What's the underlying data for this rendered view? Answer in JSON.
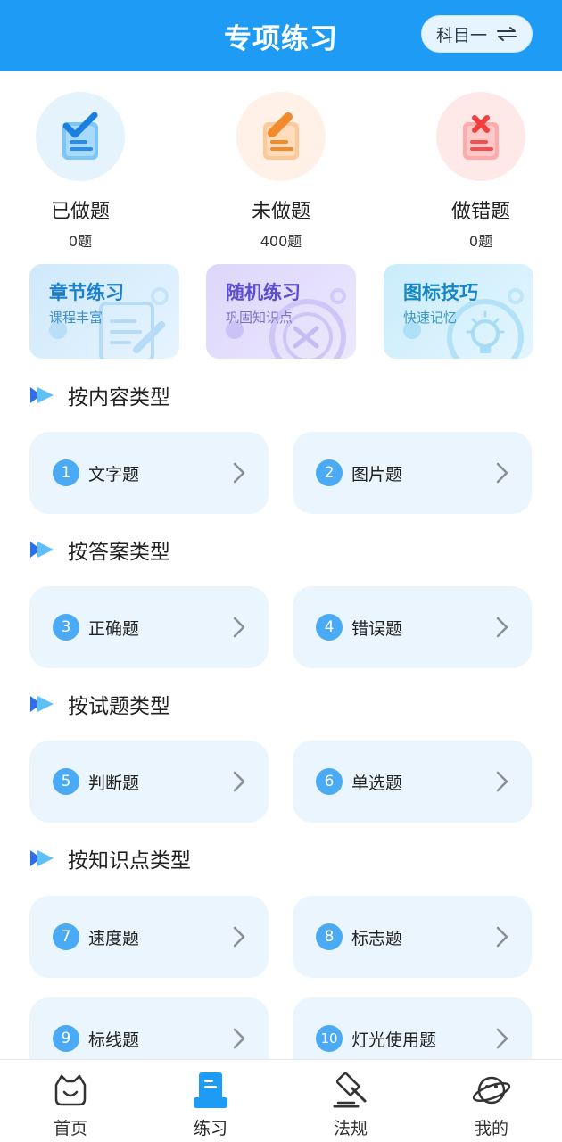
{
  "header": {
    "title": "专项练习",
    "subject_label": "科目一"
  },
  "stats": [
    {
      "label": "已做题",
      "count": "0题"
    },
    {
      "label": "未做题",
      "count": "400题"
    },
    {
      "label": "做错题",
      "count": "0题"
    }
  ],
  "features": [
    {
      "title": "章节练习",
      "subtitle": "课程丰富"
    },
    {
      "title": "随机练习",
      "subtitle": "巩固知识点"
    },
    {
      "title": "图标技巧",
      "subtitle": "快速记忆"
    }
  ],
  "sections": [
    {
      "title": "按内容类型",
      "items": [
        {
          "num": "1",
          "label": "文字题"
        },
        {
          "num": "2",
          "label": "图片题"
        }
      ]
    },
    {
      "title": "按答案类型",
      "items": [
        {
          "num": "3",
          "label": "正确题"
        },
        {
          "num": "4",
          "label": "错误题"
        }
      ]
    },
    {
      "title": "按试题类型",
      "items": [
        {
          "num": "5",
          "label": "判断题"
        },
        {
          "num": "6",
          "label": "单选题"
        }
      ]
    },
    {
      "title": "按知识点类型",
      "items": [
        {
          "num": "7",
          "label": "速度题"
        },
        {
          "num": "8",
          "label": "标志题"
        },
        {
          "num": "9",
          "label": "标线题"
        },
        {
          "num": "10",
          "label": "灯光使用题"
        }
      ]
    }
  ],
  "bottom_nav": [
    {
      "label": "首页",
      "icon": "home-face-icon"
    },
    {
      "label": "练习",
      "icon": "practice-icon",
      "active": true
    },
    {
      "label": "法规",
      "icon": "gavel-icon"
    },
    {
      "label": "我的",
      "icon": "planet-icon"
    }
  ],
  "colors": {
    "primary": "#1e9bf5",
    "item_bg": "#eaf5fd",
    "number_badge": "#4aaaf3"
  }
}
